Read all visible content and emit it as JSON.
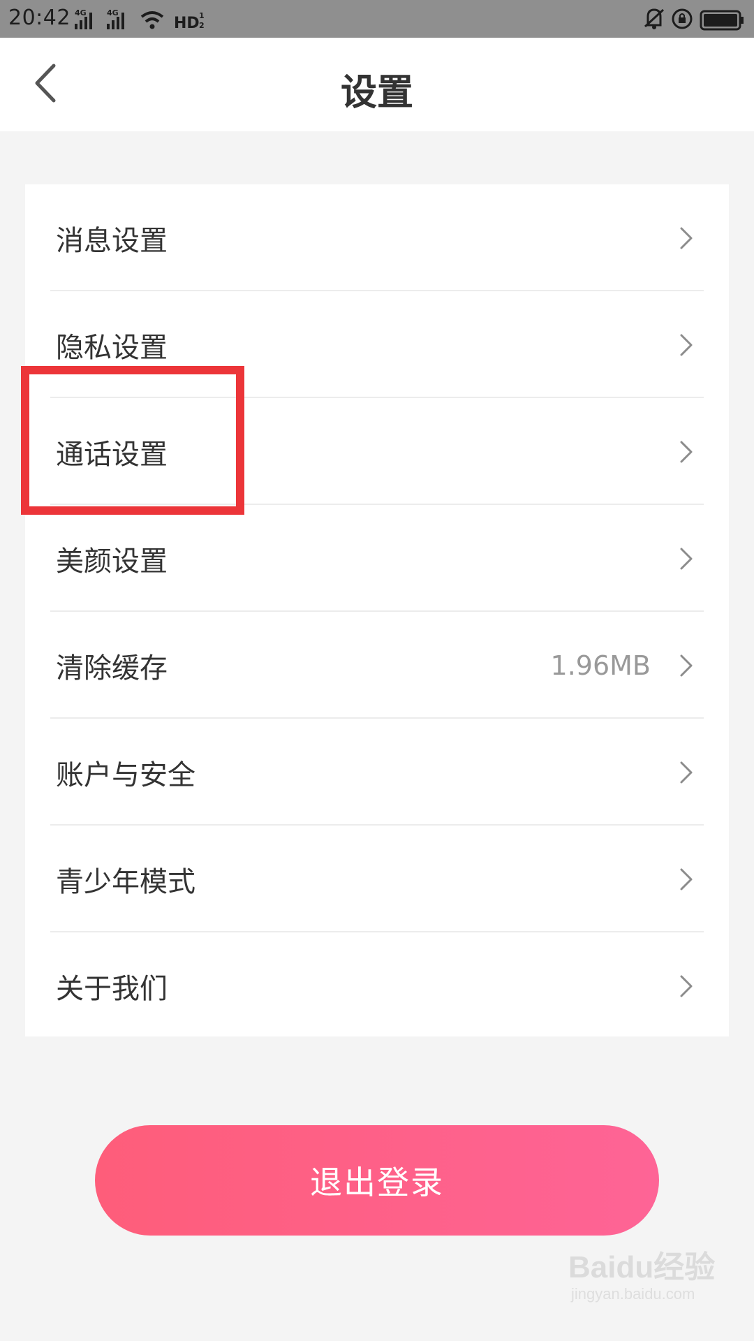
{
  "status_bar": {
    "time": "20:42",
    "network_1": "4G",
    "network_2": "4G",
    "hd_label": "HD"
  },
  "header": {
    "title": "设置",
    "back_icon": "chevron-left-icon"
  },
  "settings": {
    "items": [
      {
        "label": "消息设置",
        "value": ""
      },
      {
        "label": "隐私设置",
        "value": ""
      },
      {
        "label": "通话设置",
        "value": ""
      },
      {
        "label": "美颜设置",
        "value": ""
      },
      {
        "label": "清除缓存",
        "value": "1.96MB"
      },
      {
        "label": "账户与安全",
        "value": ""
      },
      {
        "label": "青少年模式",
        "value": ""
      },
      {
        "label": "关于我们",
        "value": ""
      }
    ]
  },
  "logout": {
    "label": "退出登录"
  },
  "watermark": {
    "logo": "Baidu经验",
    "url": "jingyan.baidu.com"
  },
  "colors": {
    "background": "#f4f4f4",
    "card": "#ffffff",
    "highlight": "#ec3539",
    "logout_gradient_start": "#fe5d7a",
    "logout_gradient_end": "#fe6496",
    "status_bar": "#8f8f8f"
  }
}
